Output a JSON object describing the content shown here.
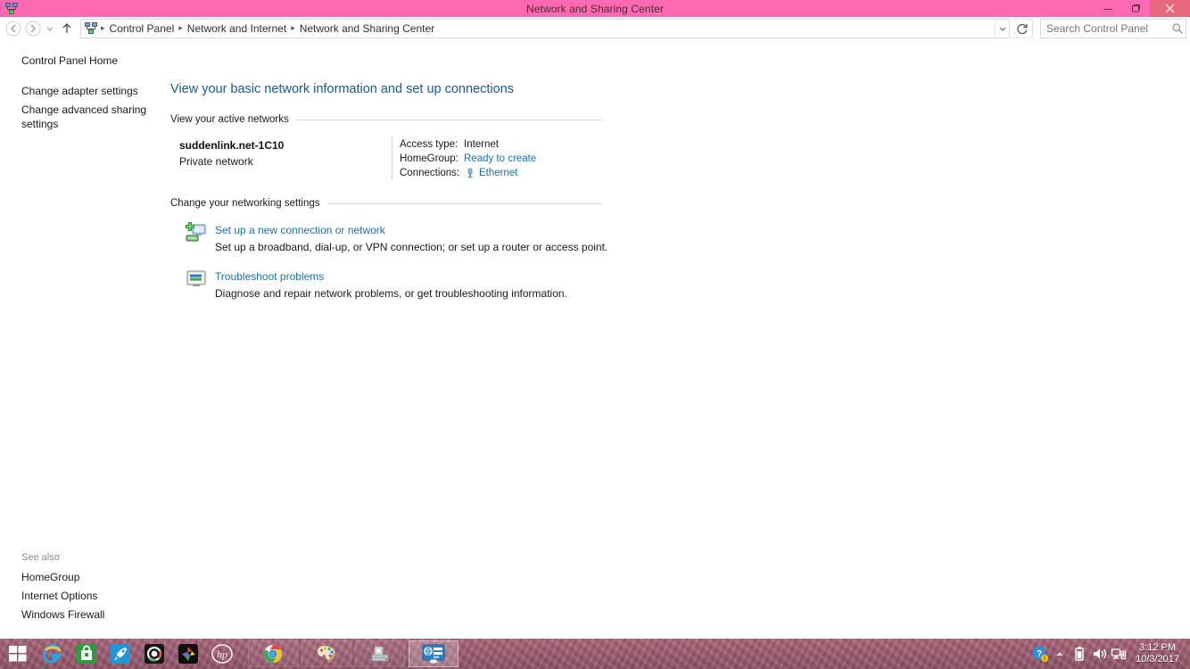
{
  "window": {
    "title": "Network and Sharing Center",
    "icon": "network-sharing-center-icon",
    "controls": {
      "minimize": "minimize-button",
      "maximize": "maximize-button",
      "close": "close-button"
    },
    "titlebar_color": "#ff69b4",
    "close_button_color": "#e8677f"
  },
  "navbar": {
    "back": "back-button",
    "forward": "forward-button",
    "recent": "recent-pages-button",
    "up": "up-button",
    "breadcrumb": [
      "Control Panel",
      "Network and Internet",
      "Network and Sharing Center"
    ],
    "breadcrumb_separator": "▸",
    "dropdown": "address-dropdown-button",
    "refresh": "refresh-button",
    "search": {
      "value": "",
      "placeholder": "Search Control Panel"
    }
  },
  "sidebar": {
    "items": [
      {
        "label": "Control Panel Home"
      },
      {
        "label": "Change adapter settings"
      },
      {
        "label": "Change advanced sharing settings"
      }
    ],
    "see_also": {
      "title": "See also",
      "items": [
        {
          "label": "HomeGroup"
        },
        {
          "label": "Internet Options"
        },
        {
          "label": "Windows Firewall"
        }
      ]
    }
  },
  "main": {
    "page_title": "View your basic network information and set up connections",
    "active_networks": {
      "section_label": "View your active networks",
      "network_name": "suddenlink.net-1C10",
      "network_type": "Private network",
      "details": [
        {
          "label": "Access type:",
          "value": "Internet",
          "is_link": false
        },
        {
          "label": "HomeGroup:",
          "value": "Ready to create",
          "is_link": true
        },
        {
          "label": "Connections:",
          "value": "Ethernet",
          "is_link": true,
          "icon": "ethernet-icon"
        }
      ]
    },
    "networking_settings": {
      "section_label": "Change your networking settings",
      "actions": [
        {
          "icon": "new-connection-icon",
          "link": "Set up a new connection or network",
          "description": "Set up a broadband, dial-up, or VPN connection; or set up a router or access point."
        },
        {
          "icon": "troubleshoot-icon",
          "link": "Troubleshoot problems",
          "description": "Diagnose and repair network problems, or get troubleshooting information."
        }
      ]
    }
  },
  "taskbar": {
    "start": "start-button",
    "quicklaunch": [
      {
        "name": "internet-explorer-icon",
        "label": "Internet Explorer"
      },
      {
        "name": "windows-store-icon",
        "label": "Store"
      },
      {
        "name": "rocket-icon",
        "label": "Launcher"
      },
      {
        "name": "camera-app-icon",
        "label": "Camera"
      },
      {
        "name": "puzzle-app-icon",
        "label": "Games"
      },
      {
        "name": "hp-icon",
        "label": "HP"
      }
    ],
    "windows": [
      {
        "name": "taskbar-window-chrome",
        "label": "Google Chrome",
        "active": false
      },
      {
        "name": "taskbar-window-paint",
        "label": "Paint",
        "active": false
      },
      {
        "name": "taskbar-window-scanner",
        "label": "Scanner and Camera Wizard",
        "active": false
      },
      {
        "name": "taskbar-window-network-sharing-center",
        "label": "Network and Sharing Center",
        "active": true
      }
    ],
    "tray": [
      {
        "name": "action-center-icon"
      },
      {
        "name": "show-hidden-icons-icon"
      },
      {
        "name": "battery-icon"
      },
      {
        "name": "volume-icon"
      },
      {
        "name": "network-icon"
      }
    ],
    "clock": {
      "time": "3:12 PM",
      "date": "10/3/2017"
    }
  },
  "colors": {
    "accent_pink": "#ff69b4",
    "link_blue": "#1a6fb5",
    "title_blue": "#1a5a8e",
    "taskbar": "#9c5f74"
  }
}
